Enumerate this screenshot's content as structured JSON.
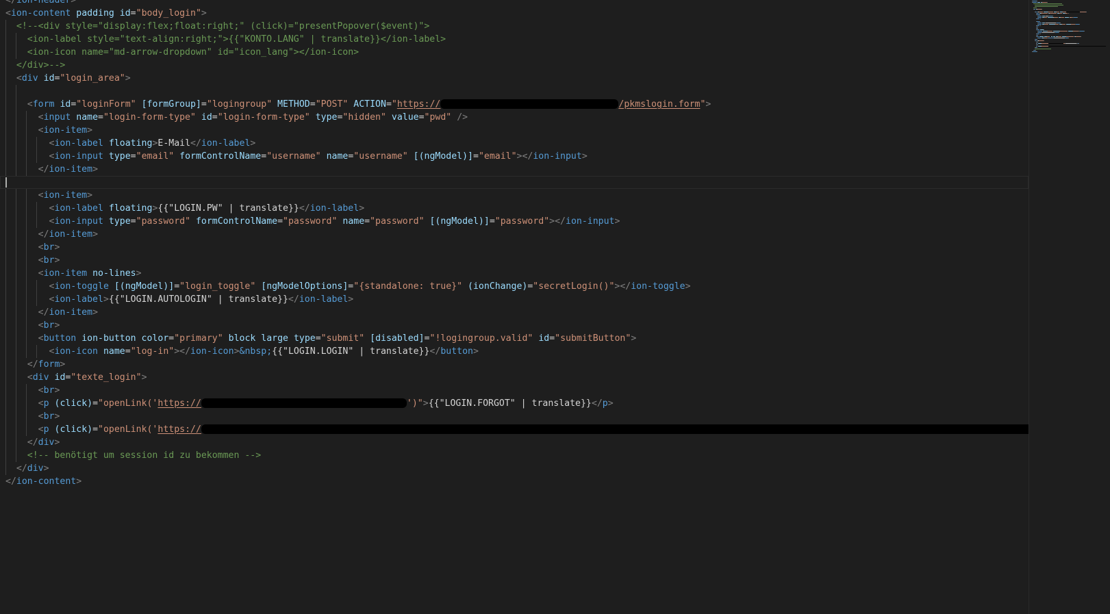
{
  "editor": {
    "lines": [
      {
        "indent": 0,
        "tokens": [
          [
            "tag",
            "</"
          ],
          [
            "el",
            "ion-header"
          ],
          [
            "tag",
            ">"
          ]
        ]
      },
      {
        "indent": 0,
        "tokens": [
          [
            "tag",
            "<"
          ],
          [
            "el",
            "ion-content"
          ],
          [
            "txt",
            " "
          ],
          [
            "attr",
            "padding"
          ],
          [
            "txt",
            " "
          ],
          [
            "attr",
            "id"
          ],
          [
            "txt",
            "="
          ],
          [
            "str",
            "\"body_login\""
          ],
          [
            "tag",
            ">"
          ]
        ]
      },
      {
        "indent": 1,
        "tokens": [
          [
            "com",
            "<!--<div style=\"display:flex;float:right;\" (click)=\"presentPopover($event)\">"
          ]
        ]
      },
      {
        "indent": 2,
        "tokens": [
          [
            "com",
            "<ion-label style=\"text-align:right;\">{{\"KONTO.LANG\" | translate}}</ion-label>"
          ]
        ]
      },
      {
        "indent": 2,
        "tokens": [
          [
            "com",
            "<ion-icon name=\"md-arrow-dropdown\" id=\"icon_lang\"></ion-icon>"
          ]
        ]
      },
      {
        "indent": 1,
        "tokens": [
          [
            "com",
            "</div>-->"
          ]
        ]
      },
      {
        "indent": 1,
        "tokens": [
          [
            "tag",
            "<"
          ],
          [
            "el",
            "div"
          ],
          [
            "txt",
            " "
          ],
          [
            "attr",
            "id"
          ],
          [
            "txt",
            "="
          ],
          [
            "str",
            "\"login_area\""
          ],
          [
            "tag",
            ">"
          ]
        ]
      },
      {
        "indent": 2,
        "tokens": []
      },
      {
        "indent": 2,
        "tokens": [
          [
            "tag",
            "<"
          ],
          [
            "el",
            "form"
          ],
          [
            "txt",
            " "
          ],
          [
            "attr",
            "id"
          ],
          [
            "txt",
            "="
          ],
          [
            "str",
            "\"loginForm\""
          ],
          [
            "txt",
            " "
          ],
          [
            "attr",
            "[formGroup]"
          ],
          [
            "txt",
            "="
          ],
          [
            "str",
            "\"logingroup\""
          ],
          [
            "txt",
            " "
          ],
          [
            "attr",
            "METHOD"
          ],
          [
            "txt",
            "="
          ],
          [
            "str",
            "\"POST\""
          ],
          [
            "txt",
            " "
          ],
          [
            "attr",
            "ACTION"
          ],
          [
            "txt",
            "="
          ],
          [
            "str",
            "\""
          ],
          [
            "url",
            "https://"
          ],
          [
            "redact",
            "260"
          ],
          [
            "url",
            "/pkmslogin.form"
          ],
          [
            "str",
            "\""
          ],
          [
            "tag",
            ">"
          ]
        ]
      },
      {
        "indent": 3,
        "tokens": [
          [
            "tag",
            "<"
          ],
          [
            "el",
            "input"
          ],
          [
            "txt",
            " "
          ],
          [
            "attr",
            "name"
          ],
          [
            "txt",
            "="
          ],
          [
            "str",
            "\"login-form-type\""
          ],
          [
            "txt",
            " "
          ],
          [
            "attr",
            "id"
          ],
          [
            "txt",
            "="
          ],
          [
            "str",
            "\"login-form-type\""
          ],
          [
            "txt",
            " "
          ],
          [
            "attr",
            "type"
          ],
          [
            "txt",
            "="
          ],
          [
            "str",
            "\"hidden\""
          ],
          [
            "txt",
            " "
          ],
          [
            "attr",
            "value"
          ],
          [
            "txt",
            "="
          ],
          [
            "str",
            "\"pwd\""
          ],
          [
            "txt",
            " "
          ],
          [
            "tag",
            "/>"
          ]
        ]
      },
      {
        "indent": 3,
        "tokens": [
          [
            "tag",
            "<"
          ],
          [
            "el",
            "ion-item"
          ],
          [
            "tag",
            ">"
          ]
        ]
      },
      {
        "indent": 4,
        "tokens": [
          [
            "tag",
            "<"
          ],
          [
            "el",
            "ion-label"
          ],
          [
            "txt",
            " "
          ],
          [
            "attr",
            "floating"
          ],
          [
            "tag",
            ">"
          ],
          [
            "txt",
            "E-Mail"
          ],
          [
            "tag",
            "</"
          ],
          [
            "el",
            "ion-label"
          ],
          [
            "tag",
            ">"
          ]
        ]
      },
      {
        "indent": 4,
        "tokens": [
          [
            "tag",
            "<"
          ],
          [
            "el",
            "ion-input"
          ],
          [
            "txt",
            " "
          ],
          [
            "attr",
            "type"
          ],
          [
            "txt",
            "="
          ],
          [
            "str",
            "\"email\""
          ],
          [
            "txt",
            " "
          ],
          [
            "attr",
            "formControlName"
          ],
          [
            "txt",
            "="
          ],
          [
            "str",
            "\"username\""
          ],
          [
            "txt",
            " "
          ],
          [
            "attr",
            "name"
          ],
          [
            "txt",
            "="
          ],
          [
            "str",
            "\"username\""
          ],
          [
            "txt",
            " "
          ],
          [
            "attr",
            "[(ngModel)]"
          ],
          [
            "txt",
            "="
          ],
          [
            "str",
            "\"email\""
          ],
          [
            "tag",
            "></"
          ],
          [
            "el",
            "ion-input"
          ],
          [
            "tag",
            ">"
          ]
        ]
      },
      {
        "indent": 3,
        "tokens": [
          [
            "tag",
            "</"
          ],
          [
            "el",
            "ion-item"
          ],
          [
            "tag",
            ">"
          ]
        ]
      },
      {
        "indent": 0,
        "current": true,
        "tokens": []
      },
      {
        "indent": 3,
        "tokens": [
          [
            "tag",
            "<"
          ],
          [
            "el",
            "ion-item"
          ],
          [
            "tag",
            ">"
          ]
        ]
      },
      {
        "indent": 4,
        "tokens": [
          [
            "tag",
            "<"
          ],
          [
            "el",
            "ion-label"
          ],
          [
            "txt",
            " "
          ],
          [
            "attr",
            "floating"
          ],
          [
            "tag",
            ">"
          ],
          [
            "txt",
            "{{\"LOGIN.PW\" | translate}}"
          ],
          [
            "tag",
            "</"
          ],
          [
            "el",
            "ion-label"
          ],
          [
            "tag",
            ">"
          ]
        ]
      },
      {
        "indent": 4,
        "tokens": [
          [
            "tag",
            "<"
          ],
          [
            "el",
            "ion-input"
          ],
          [
            "txt",
            " "
          ],
          [
            "attr",
            "type"
          ],
          [
            "txt",
            "="
          ],
          [
            "str",
            "\"password\""
          ],
          [
            "txt",
            " "
          ],
          [
            "attr",
            "formControlName"
          ],
          [
            "txt",
            "="
          ],
          [
            "str",
            "\"password\""
          ],
          [
            "txt",
            " "
          ],
          [
            "attr",
            "name"
          ],
          [
            "txt",
            "="
          ],
          [
            "str",
            "\"password\""
          ],
          [
            "txt",
            " "
          ],
          [
            "attr",
            "[(ngModel)]"
          ],
          [
            "txt",
            "="
          ],
          [
            "str",
            "\"password\""
          ],
          [
            "tag",
            "></"
          ],
          [
            "el",
            "ion-input"
          ],
          [
            "tag",
            ">"
          ]
        ]
      },
      {
        "indent": 3,
        "tokens": [
          [
            "tag",
            "</"
          ],
          [
            "el",
            "ion-item"
          ],
          [
            "tag",
            ">"
          ]
        ]
      },
      {
        "indent": 3,
        "tokens": [
          [
            "tag",
            "<"
          ],
          [
            "el",
            "br"
          ],
          [
            "tag",
            ">"
          ]
        ]
      },
      {
        "indent": 3,
        "tokens": [
          [
            "tag",
            "<"
          ],
          [
            "el",
            "br"
          ],
          [
            "tag",
            ">"
          ]
        ]
      },
      {
        "indent": 3,
        "tokens": [
          [
            "tag",
            "<"
          ],
          [
            "el",
            "ion-item"
          ],
          [
            "txt",
            " "
          ],
          [
            "attr",
            "no-lines"
          ],
          [
            "tag",
            ">"
          ]
        ]
      },
      {
        "indent": 4,
        "tokens": [
          [
            "tag",
            "<"
          ],
          [
            "el",
            "ion-toggle"
          ],
          [
            "txt",
            " "
          ],
          [
            "attr",
            "[(ngModel)]"
          ],
          [
            "txt",
            "="
          ],
          [
            "str",
            "\"login_toggle\""
          ],
          [
            "txt",
            " "
          ],
          [
            "attr",
            "[ngModelOptions]"
          ],
          [
            "txt",
            "="
          ],
          [
            "str",
            "\"{standalone: true}\""
          ],
          [
            "txt",
            " "
          ],
          [
            "attr",
            "(ionChange)"
          ],
          [
            "txt",
            "="
          ],
          [
            "str",
            "\"secretLogin()\""
          ],
          [
            "tag",
            "></"
          ],
          [
            "el",
            "ion-toggle"
          ],
          [
            "tag",
            ">"
          ]
        ]
      },
      {
        "indent": 4,
        "tokens": [
          [
            "tag",
            "<"
          ],
          [
            "el",
            "ion-label"
          ],
          [
            "tag",
            ">"
          ],
          [
            "txt",
            "{{\"LOGIN.AUTOLOGIN\" | translate}}"
          ],
          [
            "tag",
            "</"
          ],
          [
            "el",
            "ion-label"
          ],
          [
            "tag",
            ">"
          ]
        ]
      },
      {
        "indent": 3,
        "tokens": [
          [
            "tag",
            "</"
          ],
          [
            "el",
            "ion-item"
          ],
          [
            "tag",
            ">"
          ]
        ]
      },
      {
        "indent": 3,
        "tokens": [
          [
            "tag",
            "<"
          ],
          [
            "el",
            "br"
          ],
          [
            "tag",
            ">"
          ]
        ]
      },
      {
        "indent": 3,
        "tokens": [
          [
            "tag",
            "<"
          ],
          [
            "el",
            "button"
          ],
          [
            "txt",
            " "
          ],
          [
            "attr",
            "ion-button"
          ],
          [
            "txt",
            " "
          ],
          [
            "attr",
            "color"
          ],
          [
            "txt",
            "="
          ],
          [
            "str",
            "\"primary\""
          ],
          [
            "txt",
            " "
          ],
          [
            "attr",
            "block"
          ],
          [
            "txt",
            " "
          ],
          [
            "attr",
            "large"
          ],
          [
            "txt",
            " "
          ],
          [
            "attr",
            "type"
          ],
          [
            "txt",
            "="
          ],
          [
            "str",
            "\"submit\""
          ],
          [
            "txt",
            " "
          ],
          [
            "attr",
            "[disabled]"
          ],
          [
            "txt",
            "="
          ],
          [
            "str",
            "\"!logingroup.valid\""
          ],
          [
            "txt",
            " "
          ],
          [
            "attr",
            "id"
          ],
          [
            "txt",
            "="
          ],
          [
            "str",
            "\"submitButton\""
          ],
          [
            "tag",
            ">"
          ]
        ]
      },
      {
        "indent": 4,
        "tokens": [
          [
            "tag",
            "<"
          ],
          [
            "el",
            "ion-icon"
          ],
          [
            "txt",
            " "
          ],
          [
            "attr",
            "name"
          ],
          [
            "txt",
            "="
          ],
          [
            "str",
            "\"log-in\""
          ],
          [
            "tag",
            "></"
          ],
          [
            "el",
            "ion-icon"
          ],
          [
            "tag",
            ">"
          ],
          [
            "ent",
            "&nbsp;"
          ],
          [
            "txt",
            "{{\"LOGIN.LOGIN\" | translate}}"
          ],
          [
            "tag",
            "</"
          ],
          [
            "el",
            "button"
          ],
          [
            "tag",
            ">"
          ]
        ]
      },
      {
        "indent": 2,
        "tokens": [
          [
            "tag",
            "</"
          ],
          [
            "el",
            "form"
          ],
          [
            "tag",
            ">"
          ]
        ]
      },
      {
        "indent": 2,
        "tokens": [
          [
            "tag",
            "<"
          ],
          [
            "el",
            "div"
          ],
          [
            "txt",
            " "
          ],
          [
            "attr",
            "id"
          ],
          [
            "txt",
            "="
          ],
          [
            "str",
            "\"texte_login\""
          ],
          [
            "tag",
            ">"
          ]
        ]
      },
      {
        "indent": 3,
        "tokens": [
          [
            "tag",
            "<"
          ],
          [
            "el",
            "br"
          ],
          [
            "tag",
            ">"
          ]
        ]
      },
      {
        "indent": 3,
        "tokens": [
          [
            "tag",
            "<"
          ],
          [
            "el",
            "p"
          ],
          [
            "txt",
            " "
          ],
          [
            "attr",
            "(click)"
          ],
          [
            "txt",
            "="
          ],
          [
            "str",
            "\"openLink('"
          ],
          [
            "url",
            "https://"
          ],
          [
            "redact",
            "300"
          ],
          [
            "str",
            "')\""
          ],
          [
            "tag",
            ">"
          ],
          [
            "txt",
            "{{\"LOGIN.FORGOT\" | translate}}"
          ],
          [
            "tag",
            "</"
          ],
          [
            "el",
            "p"
          ],
          [
            "tag",
            ">"
          ]
        ]
      },
      {
        "indent": 3,
        "tokens": [
          [
            "tag",
            "<"
          ],
          [
            "el",
            "br"
          ],
          [
            "tag",
            ">"
          ]
        ]
      },
      {
        "indent": 3,
        "tokens": [
          [
            "tag",
            "<"
          ],
          [
            "el",
            "p"
          ],
          [
            "txt",
            " "
          ],
          [
            "attr",
            "(click)"
          ],
          [
            "txt",
            "="
          ],
          [
            "str",
            "\"openLink('"
          ],
          [
            "url",
            "https://"
          ],
          [
            "redact",
            "1222"
          ]
        ]
      },
      {
        "indent": 2,
        "tokens": [
          [
            "tag",
            "</"
          ],
          [
            "el",
            "div"
          ],
          [
            "tag",
            ">"
          ]
        ]
      },
      {
        "indent": 2,
        "tokens": [
          [
            "com",
            "<!-- benötigt um session id zu bekommen -->"
          ]
        ]
      },
      {
        "indent": 1,
        "tokens": [
          [
            "tag",
            "</"
          ],
          [
            "el",
            "div"
          ],
          [
            "tag",
            ">"
          ]
        ]
      },
      {
        "indent": 0,
        "tokens": [
          [
            "tag",
            "</"
          ],
          [
            "el",
            "ion-content"
          ],
          [
            "tag",
            ">"
          ]
        ]
      }
    ]
  },
  "colors": {
    "background": "#1e1e1e",
    "tag": "#808080",
    "element": "#569cd6",
    "attribute": "#9cdcfe",
    "string": "#ce9178",
    "comment": "#6a9955",
    "text": "#d4d4d4"
  }
}
